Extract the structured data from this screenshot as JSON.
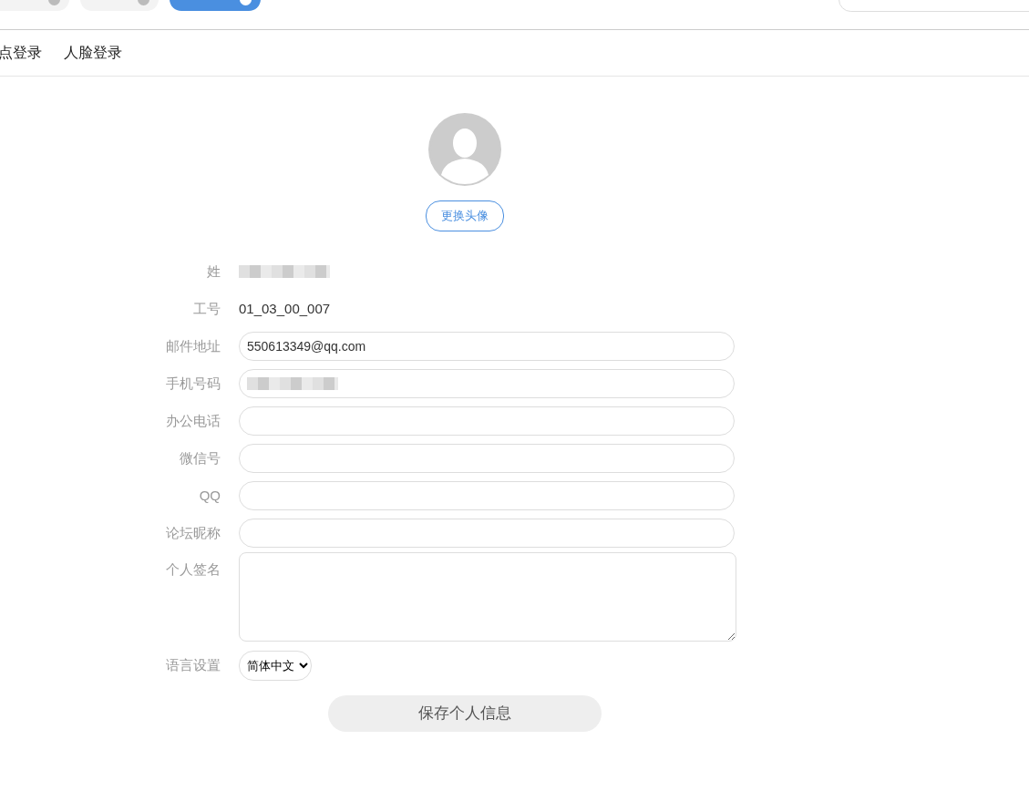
{
  "top_tabs": [
    {
      "selected": false
    },
    {
      "selected": false
    },
    {
      "selected": true
    }
  ],
  "sub_tabs": [
    {
      "label": "点登录"
    },
    {
      "label": "人脸登录"
    }
  ],
  "avatar": {
    "button": "更换头像"
  },
  "fields": [
    {
      "kind": "text",
      "label": "姓",
      "redacted": true
    },
    {
      "kind": "text",
      "label": "工号",
      "value": "01_03_00_007"
    },
    {
      "kind": "input",
      "label": "邮件地址",
      "value": "550613349@qq.com"
    },
    {
      "kind": "input",
      "label": "手机号码",
      "redacted": true
    },
    {
      "kind": "input",
      "label": "办公电话"
    },
    {
      "kind": "input",
      "label": "微信号"
    },
    {
      "kind": "input",
      "label": "QQ"
    },
    {
      "kind": "input",
      "label": "论坛昵称"
    },
    {
      "kind": "textarea",
      "label": "个人签名"
    },
    {
      "kind": "select",
      "label": "语言设置",
      "value": "简体中文"
    }
  ],
  "save_button": "保存个人信息"
}
